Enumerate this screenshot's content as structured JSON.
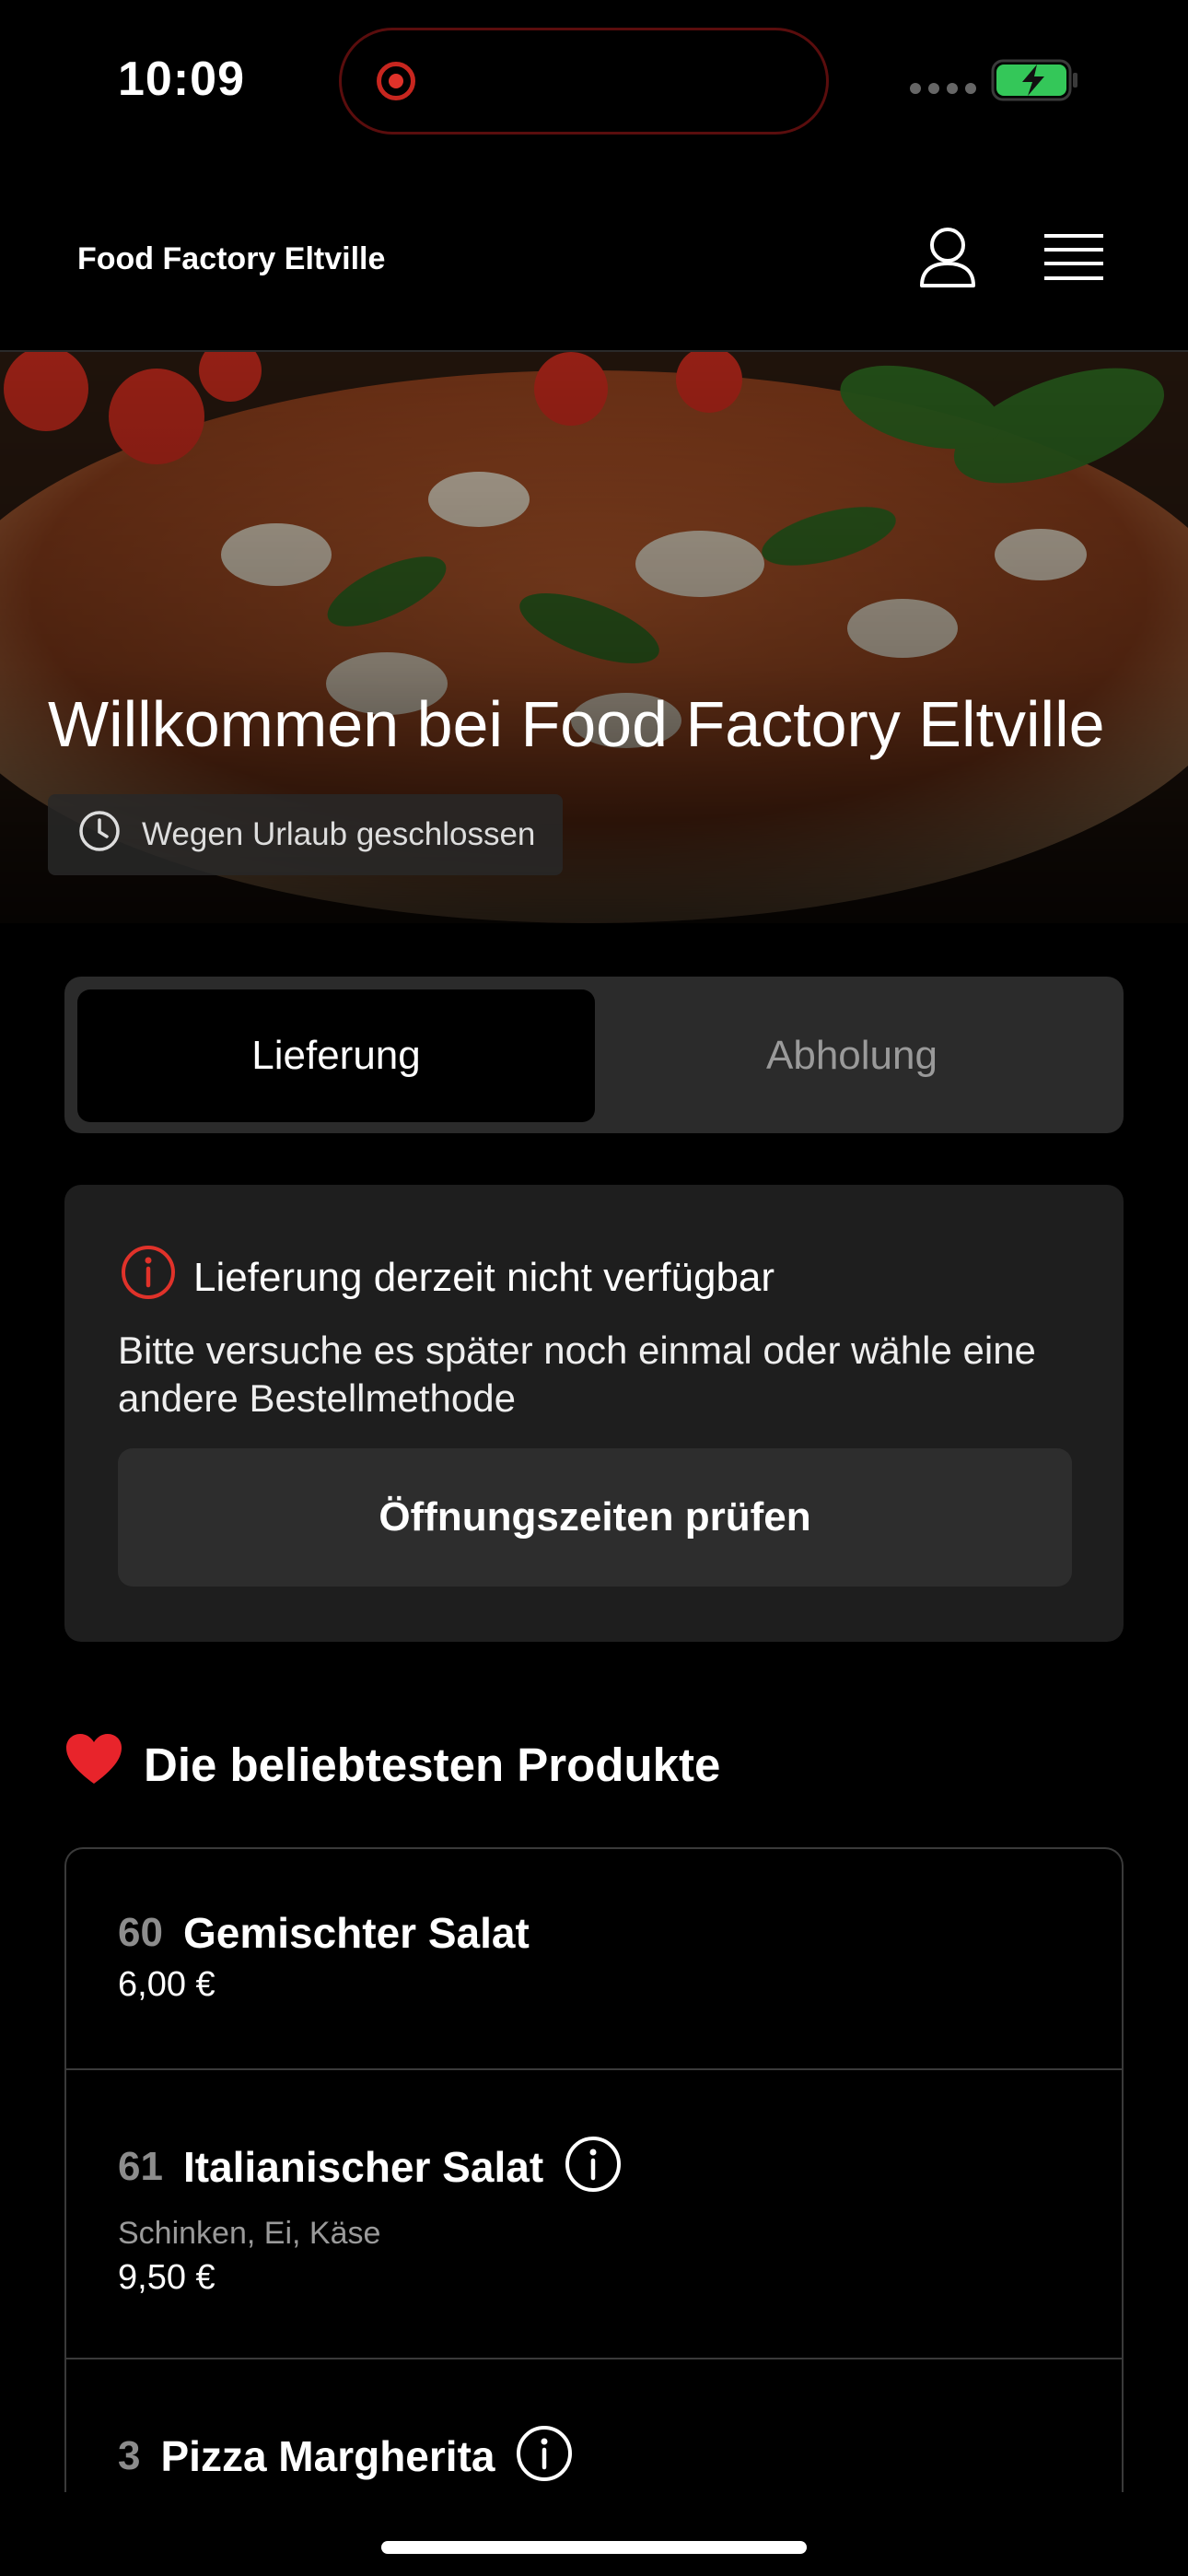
{
  "status_bar": {
    "time": "10:09"
  },
  "header": {
    "brand": "Food Factory Eltville",
    "icons": [
      "user-icon",
      "menu-icon"
    ]
  },
  "hero": {
    "title": "Willkommen bei Food Factory Eltville",
    "status": "Wegen Urlaub geschlossen"
  },
  "order_mode": {
    "options": [
      "Lieferung",
      "Abholung"
    ],
    "selected": "Lieferung"
  },
  "notice": {
    "title": "Lieferung derzeit nicht verfügbar",
    "message": "Bitte versuche es später noch einmal oder wähle eine andere Bestellmethode",
    "button": "Öffnungszeiten prüfen"
  },
  "popular": {
    "title": "Die beliebtesten Produkte",
    "items": [
      {
        "number": "60",
        "name": "Gemischter Salat",
        "description": "",
        "price": "6,00 €"
      },
      {
        "number": "61",
        "name": "Italianischer Salat",
        "description": "Schinken, Ei, Käse",
        "price": "9,50 €"
      },
      {
        "number": "3",
        "name": "Pizza Margherita",
        "description": "",
        "price": ""
      }
    ]
  },
  "colors": {
    "background": "#000000",
    "card": "#1e1e1e",
    "alert": "#e0322a",
    "muted": "#9a9a9a"
  }
}
